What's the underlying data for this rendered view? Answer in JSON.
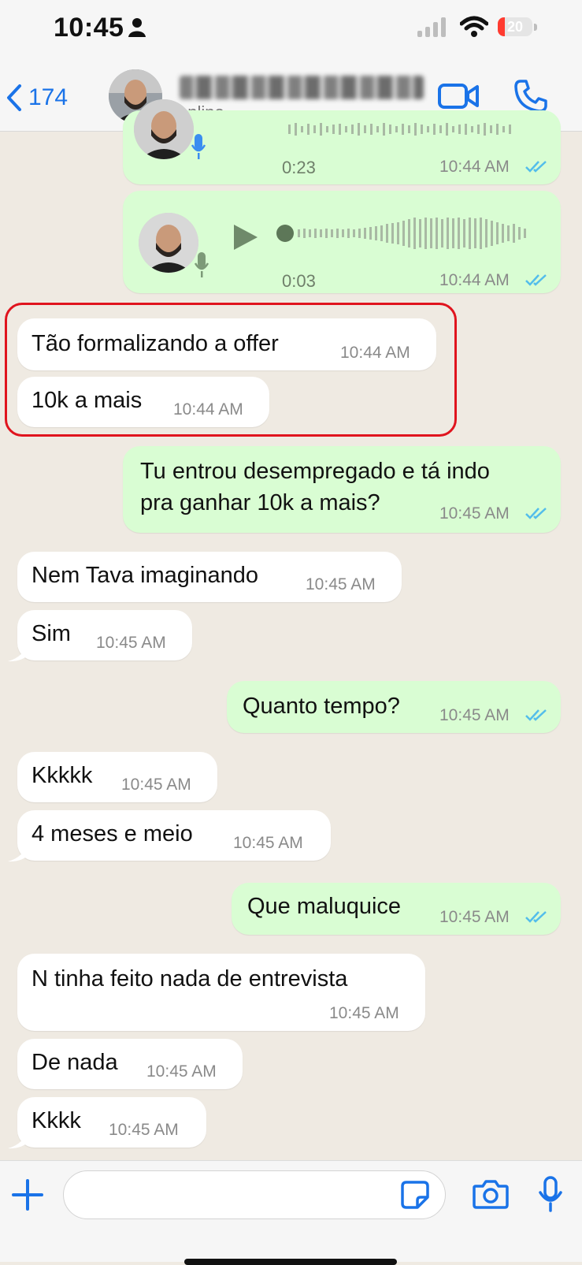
{
  "status_bar": {
    "time": "10:45",
    "battery": "20"
  },
  "header": {
    "back_count": "174",
    "contact_status": "online"
  },
  "voice_messages": [
    {
      "duration": "0:23",
      "time": "10:44 AM"
    },
    {
      "duration": "0:03",
      "time": "10:44 AM"
    }
  ],
  "messages": [
    {
      "text": "Tão formalizando a offer",
      "time": "10:44 AM"
    },
    {
      "text": "10k a mais",
      "time": "10:44 AM"
    },
    {
      "text_line1": "Tu entrou desempregado e tá indo",
      "text_line2": "pra ganhar 10k a mais?",
      "time": "10:45 AM"
    },
    {
      "text": "Nem Tava imaginando",
      "time": "10:45 AM"
    },
    {
      "text": "Sim",
      "time": "10:45 AM"
    },
    {
      "text": "Quanto tempo?",
      "time": "10:45 AM"
    },
    {
      "text": "Kkkkk",
      "time": "10:45 AM"
    },
    {
      "text": "4 meses e meio",
      "time": "10:45 AM"
    },
    {
      "text": "Que maluquice",
      "time": "10:45 AM"
    },
    {
      "text": "N tinha feito nada de entrevista",
      "time": "10:45 AM"
    },
    {
      "text": "De nada",
      "time": "10:45 AM"
    },
    {
      "text": "Kkkk",
      "time": "10:45 AM"
    }
  ],
  "colors": {
    "accent": "#1a73e8",
    "outgoing_bubble": "#d9fdd3",
    "incoming_bubble": "#ffffff",
    "chat_bg": "#efeae2",
    "highlight": "#e0141e",
    "read_ticks": "#53bdeb"
  }
}
